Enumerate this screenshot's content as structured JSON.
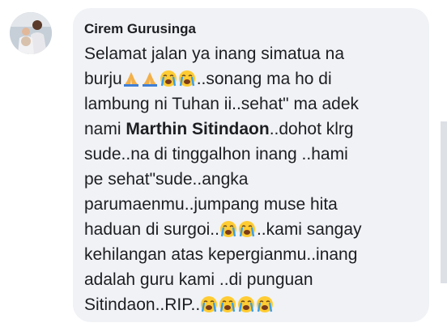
{
  "comment": {
    "author": "Cirem Gurusinga",
    "line1": "Selamat jalan ya inang simatua na",
    "line2_a": "burju",
    "line2_b": "..sonang ma ho di",
    "line3": "lambung ni Tuhan ii..sehat\" ma adek",
    "line4_a": "nami ",
    "line4_mention": "Marthin Sitindaon",
    "line4_b": "..dohot klrg",
    "line5": "sude..na di tinggalhon inang ..hami",
    "line6": "pe sehat\"sude..angka",
    "line7": "parumaenmu..jumpang muse hita",
    "line8_a": "haduan di surgoi..",
    "line8_b": "..kami sangay",
    "line9": "kehilangan atas kepergianmu..inang",
    "line10": "adalah guru kami ..di punguan",
    "line11_a": "Sitindaon..RIP.."
  },
  "emoji": {
    "line2": [
      "folded-hands",
      "folded-hands",
      "loudly-crying-face",
      "loudly-crying-face"
    ],
    "line8": [
      "loudly-crying-face",
      "loudly-crying-face"
    ],
    "line11": [
      "loudly-crying-face",
      "loudly-crying-face",
      "loudly-crying-face",
      "loudly-crying-face"
    ]
  },
  "colors": {
    "bubble": "#f0f2f5",
    "text": "#1c1e21",
    "emoji_face": "#ffcc33",
    "emoji_tears": "#3b9ee8",
    "hands": "#f3b04a"
  }
}
